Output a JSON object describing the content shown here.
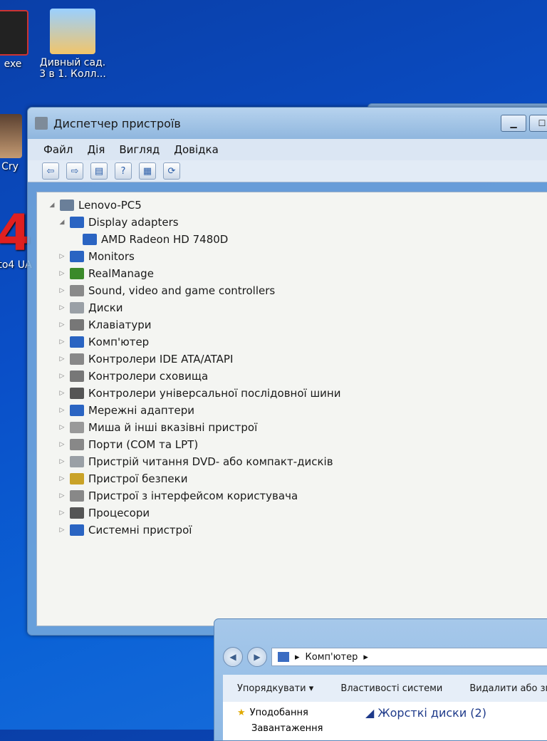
{
  "desktop": {
    "icons": [
      {
        "label": "exe"
      },
      {
        "label": "Дивный сад. 3 в 1. Колл..."
      },
      {
        "label": "Cry"
      },
      {
        "label": "to4 UA"
      }
    ],
    "big_digit": "4"
  },
  "device_manager": {
    "title": "Диспетчер пристроїв",
    "menu": [
      "Файл",
      "Дія",
      "Вигляд",
      "Довідка"
    ],
    "root": "Lenovo-PC5",
    "categories": [
      {
        "label": "Display adapters",
        "expanded": true,
        "children": [
          "AMD Radeon HD 7480D"
        ],
        "icon_color": "#2a64c2",
        "icon": "display-adapter-icon"
      },
      {
        "label": "Monitors",
        "icon_color": "#2a64c2",
        "icon": "monitor-icon"
      },
      {
        "label": "RealManage",
        "icon_color": "#3b8a2a",
        "icon": "network-icon"
      },
      {
        "label": "Sound, video and game controllers",
        "icon_color": "#8a8a8a",
        "icon": "speaker-icon"
      },
      {
        "label": "Диски",
        "icon_color": "#9aa0a6",
        "icon": "disk-icon"
      },
      {
        "label": "Клавіатури",
        "icon_color": "#777777",
        "icon": "keyboard-icon"
      },
      {
        "label": "Комп'ютер",
        "icon_color": "#2a64c2",
        "icon": "computer-icon"
      },
      {
        "label": "Контролери IDE ATA/ATAPI",
        "icon_color": "#888888",
        "icon": "ide-icon"
      },
      {
        "label": "Контролери сховища",
        "icon_color": "#777777",
        "icon": "storage-icon"
      },
      {
        "label": "Контролери універсальної послідовної шини",
        "icon_color": "#555555",
        "icon": "usb-icon"
      },
      {
        "label": "Мережні адаптери",
        "icon_color": "#2a64c2",
        "icon": "network-adapter-icon"
      },
      {
        "label": "Миша й інші вказівні пристрої",
        "icon_color": "#999999",
        "icon": "mouse-icon"
      },
      {
        "label": "Порти (COM та LPT)",
        "icon_color": "#888888",
        "icon": "port-icon"
      },
      {
        "label": "Пристрій читання DVD- або компакт-дисків",
        "icon_color": "#9aa0a6",
        "icon": "dvd-icon"
      },
      {
        "label": "Пристрої безпеки",
        "icon_color": "#c9a227",
        "icon": "key-icon"
      },
      {
        "label": "Пристрої з інтерфейсом користувача",
        "icon_color": "#888888",
        "icon": "hid-icon"
      },
      {
        "label": "Процесори",
        "icon_color": "#555555",
        "icon": "processor-icon"
      },
      {
        "label": "Системні пристрої",
        "icon_color": "#2a64c2",
        "icon": "system-device-icon"
      }
    ]
  },
  "explorer": {
    "address": "Комп'ютер",
    "commands": [
      "Упорядкувати",
      "Властивості системи",
      "Видалити або змі"
    ],
    "favorites": "Уподобання",
    "downloads": "Завантаження",
    "group": "Жорсткі диски (2)"
  }
}
